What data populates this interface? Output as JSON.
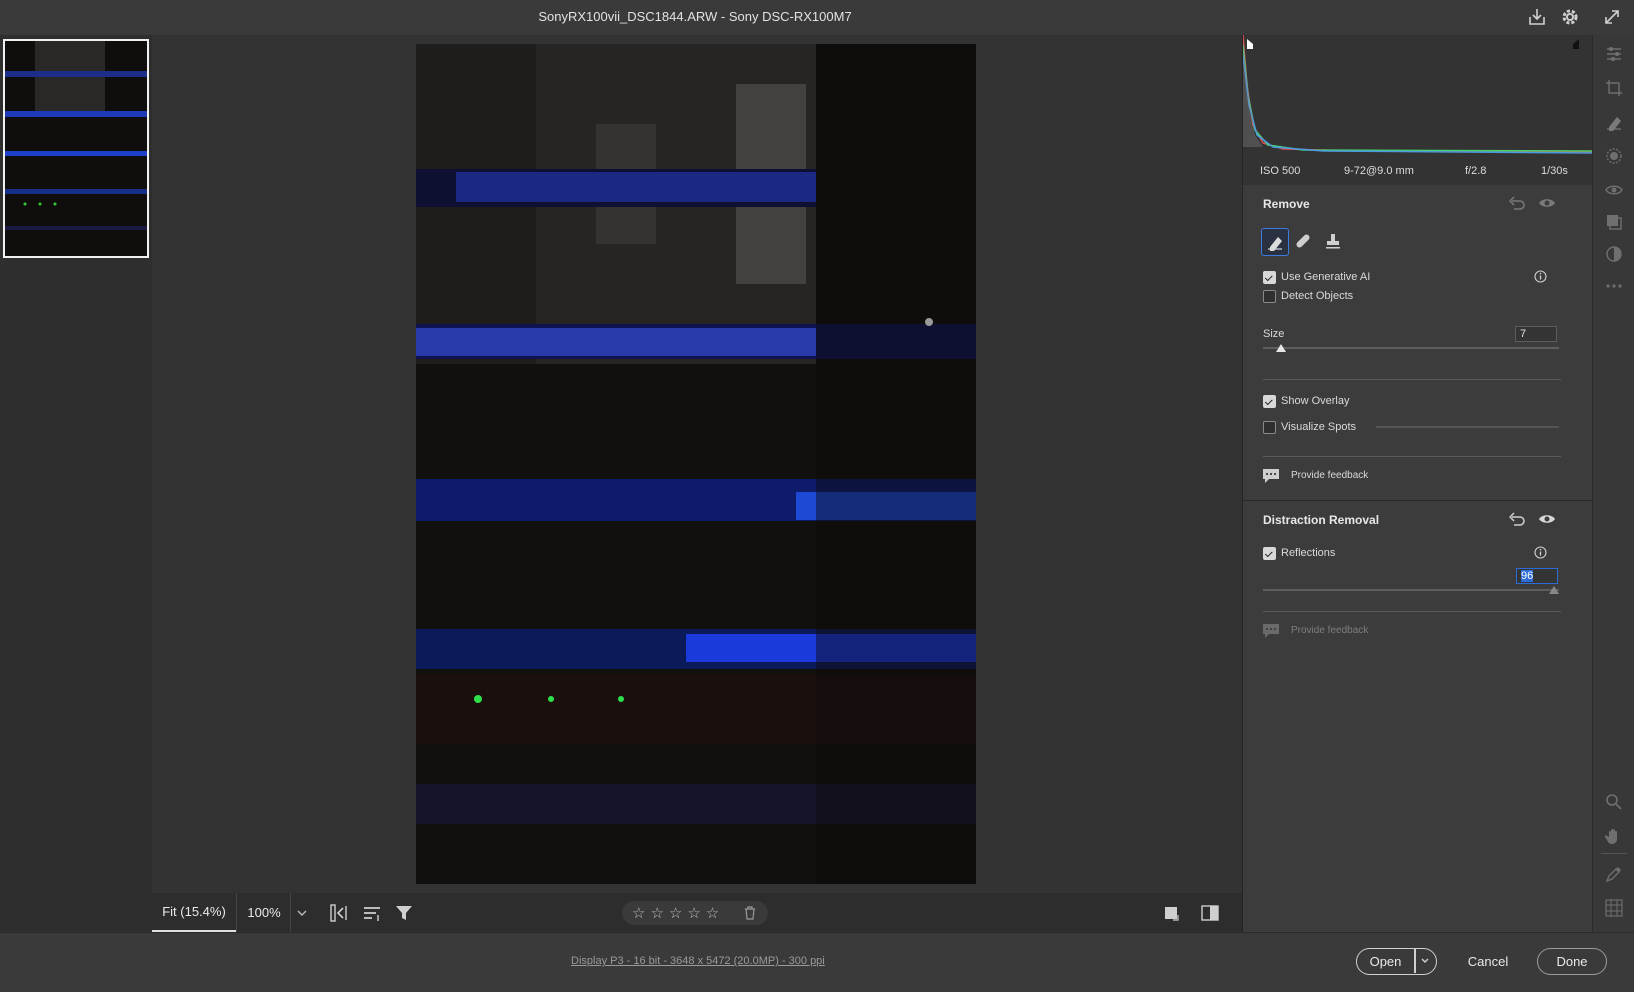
{
  "window": {
    "title": "SonyRX100vii_DSC1844.ARW  -  Sony DSC-RX100M7"
  },
  "histogram": {
    "iso": "ISO 500",
    "lens": "9-72@9.0 mm",
    "aperture": "f/2.8",
    "shutter": "1/30s"
  },
  "remove": {
    "title": "Remove",
    "use_generative_ai_label": "Use Generative AI",
    "use_generative_ai_checked": true,
    "detect_objects_label": "Detect Objects",
    "detect_objects_checked": false,
    "size_label": "Size",
    "size_value": "7",
    "show_overlay_label": "Show Overlay",
    "show_overlay_checked": true,
    "visualize_spots_label": "Visualize Spots",
    "visualize_spots_checked": false,
    "feedback_label": "Provide feedback"
  },
  "distraction": {
    "title": "Distraction Removal",
    "reflections_label": "Reflections",
    "reflections_checked": true,
    "reflections_value": "96",
    "feedback_label": "Provide feedback"
  },
  "bottom_bar": {
    "fit_label": "Fit (15.4%)",
    "zoom_label": "100%"
  },
  "footer": {
    "info_link": "Display P3 - 16 bit - 3648 x 5472 (20.0MP) - 300 ppi",
    "open_label": "Open",
    "cancel_label": "Cancel",
    "done_label": "Done"
  },
  "colors": {
    "panel_bg": "#3c3c3c",
    "canvas_bg": "#333333",
    "accent_blue": "#2d6bd6"
  }
}
